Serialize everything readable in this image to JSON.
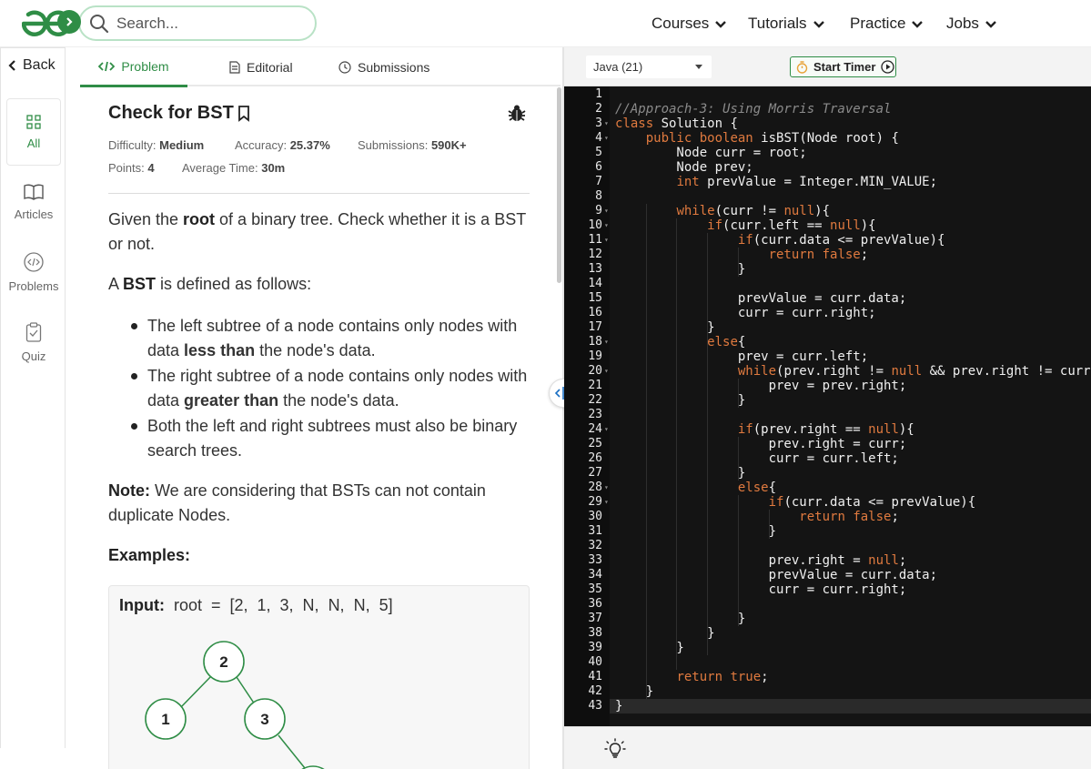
{
  "nav": {
    "search_placeholder": "Search...",
    "menus": [
      "Courses",
      "Tutorials",
      "Practice",
      "Jobs"
    ],
    "brand_color": "#2f8d46"
  },
  "sidebar": {
    "back_label": "Back",
    "items": [
      {
        "label": "All",
        "icon": "grid-icon",
        "active": true
      },
      {
        "label": "Articles",
        "icon": "book-icon",
        "active": false
      },
      {
        "label": "Problems",
        "icon": "code-icon",
        "active": false
      },
      {
        "label": "Quiz",
        "icon": "clipboard-icon",
        "active": false
      }
    ]
  },
  "tabs": [
    {
      "label": "Problem",
      "icon": "code-icon",
      "active": true
    },
    {
      "label": "Editorial",
      "icon": "document-icon",
      "active": false
    },
    {
      "label": "Submissions",
      "icon": "clock-icon",
      "active": false
    }
  ],
  "problem": {
    "title": "Check for BST",
    "difficulty_label": "Difficulty:",
    "difficulty": "Medium",
    "accuracy_label": "Accuracy:",
    "accuracy": "25.37%",
    "submissions_label": "Submissions:",
    "submissions": "590K+",
    "points_label": "Points:",
    "points": "4",
    "avg_time_label": "Average Time:",
    "avg_time": "30m",
    "desc_1a": "Given the ",
    "desc_1b": "root",
    "desc_1c": " of a binary tree. Check whether it is a BST or not.",
    "desc_2a": "A ",
    "desc_2b": "BST",
    "desc_2c": " is defined as follows:",
    "bullet_1a": "The left subtree of a node contains only nodes with data ",
    "bullet_1b": "less than",
    "bullet_1c": " the node's data.",
    "bullet_2a": "The right subtree of a node contains only nodes with data ",
    "bullet_2b": "greater than",
    "bullet_2c": " the node's data.",
    "bullet_3": "Both the left and right subtrees must also be binary search trees.",
    "note_label": "Note:",
    "note_text": " We are considering that BSTs can not contain duplicate Nodes.",
    "examples_label": "Examples:",
    "input_label": "Input:",
    "input_value": "  root  =  [2,  1,  3,  N,  N,  N,  5]",
    "tree_nodes": [
      "2",
      "1",
      "3"
    ]
  },
  "editor": {
    "language": "Java (21)",
    "timer_label": "Start Timer",
    "code_lines": [
      "",
      "//Approach-3: Using Morris Traversal",
      "class Solution {",
      "    public boolean isBST(Node root) {",
      "        Node curr = root;",
      "        Node prev;",
      "        int prevValue = Integer.MIN_VALUE;",
      "",
      "        while(curr != null){",
      "            if(curr.left == null){",
      "                if(curr.data <= prevValue){",
      "                    return false;",
      "                }",
      "",
      "                prevValue = curr.data;",
      "                curr = curr.right;",
      "            }",
      "            else{",
      "                prev = curr.left;",
      "                while(prev.right != null && prev.right != curr){",
      "                    prev = prev.right;",
      "                }",
      "",
      "                if(prev.right == null){",
      "                    prev.right = curr;",
      "                    curr = curr.left;",
      "                }",
      "                else{",
      "                    if(curr.data <= prevValue){",
      "                        return false;",
      "                    }",
      "",
      "                    prev.right = null;",
      "                    prevValue = curr.data;",
      "                    curr = curr.right;",
      "",
      "                }",
      "            }",
      "        }",
      "",
      "        return true;",
      "    }",
      "}"
    ],
    "fold_lines": [
      3,
      4,
      9,
      10,
      11,
      18,
      20,
      24,
      28,
      29
    ]
  }
}
